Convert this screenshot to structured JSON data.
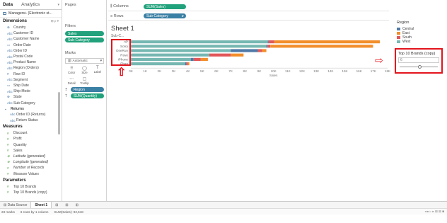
{
  "data_pane": {
    "tab_data": "Data",
    "tab_analytics": "Analytics",
    "datasource": "Managers+ (Electronic st...",
    "dimensions_title": "Dimensions",
    "dimensions_tools": "⊞ ρ ▾",
    "dimensions": [
      {
        "icon": "⊕",
        "label": "Country"
      },
      {
        "icon": "Abc",
        "label": "Customer ID"
      },
      {
        "icon": "Abc",
        "label": "Customer Name"
      },
      {
        "icon": "▭",
        "label": "Order Date"
      },
      {
        "icon": "Abc",
        "label": "Order ID"
      },
      {
        "icon": "Abc",
        "label": "Postal Code"
      },
      {
        "icon": "Abc",
        "label": "Product Name"
      },
      {
        "icon": "Abc",
        "label": "Region (Orders)"
      },
      {
        "icon": "#",
        "label": "Row ID"
      },
      {
        "icon": "Abc",
        "label": "Segment"
      },
      {
        "icon": "▭",
        "label": "Ship Date"
      },
      {
        "icon": "Abc",
        "label": "Ship Mode"
      },
      {
        "icon": "⊕",
        "label": "State"
      },
      {
        "icon": "Abc",
        "label": "Sub-Category"
      }
    ],
    "returns_group": "Returns",
    "returns_fields": [
      {
        "icon": "Abc",
        "label": "Order ID (Returns)"
      },
      {
        "icon": "Abc",
        "label": "Return Status"
      }
    ],
    "measures_title": "Measures",
    "measures": [
      {
        "icon": "#",
        "label": "Discount",
        "italic": false
      },
      {
        "icon": "#",
        "label": "Profit",
        "italic": false
      },
      {
        "icon": "#",
        "label": "Quantity",
        "italic": false
      },
      {
        "icon": "#",
        "label": "Sales",
        "italic": false
      },
      {
        "icon": "⊕",
        "label": "Latitude (generated)",
        "italic": true
      },
      {
        "icon": "⊕",
        "label": "Longitude (generated)",
        "italic": true
      },
      {
        "icon": "#",
        "label": "Number of Records",
        "italic": true
      },
      {
        "icon": "#",
        "label": "Measure Values",
        "italic": true
      }
    ],
    "parameters_title": "Parameters",
    "parameters": [
      {
        "icon": "#",
        "label": "Top 10 Brands"
      },
      {
        "icon": "#",
        "label": "Top 10 Brands (copy)"
      }
    ]
  },
  "cards": {
    "pages_title": "Pages",
    "filters_title": "Filters",
    "filters": [
      "Sales",
      "Sub-Category"
    ],
    "marks_title": "Marks",
    "mark_type": "Automatic",
    "mark_buttons": [
      {
        "icon": "⠿",
        "label": "Color"
      },
      {
        "icon": "◯",
        "label": "Size"
      },
      {
        "icon": "T",
        "label": "Label"
      },
      {
        "icon": "⋯",
        "label": "Detail"
      },
      {
        "icon": "▢",
        "label": "Tooltip"
      }
    ],
    "mark_fields": [
      {
        "icon": "⠿",
        "label": "Region",
        "color": "blue"
      },
      {
        "icon": "T",
        "label": "SUM(Quantity)",
        "color": "green"
      }
    ]
  },
  "shelves": {
    "columns_label": "Columns",
    "columns_pill": "SUM(Sales)",
    "rows_label": "Rows",
    "rows_pill": "Sub-Category"
  },
  "view": {
    "sheet_title": "Sheet 1",
    "row_header": "Sub-C..."
  },
  "chart_data": {
    "type": "bar",
    "orientation": "horizontal",
    "stacked": true,
    "categories": [
      "nP",
      "Sorry",
      "OneRun",
      "Rove",
      "iPhone",
      "Phan"
    ],
    "series": [
      {
        "name": "Central",
        "color": "#4e79a7",
        "values": [
          0.06,
          0.08,
          1.9,
          0,
          0.2,
          0.1
        ]
      },
      {
        "name": "East",
        "color": "#f28e2b",
        "values": [
          7.4,
          7.2,
          0.3,
          0.9,
          0.5,
          0.1
        ]
      },
      {
        "name": "South",
        "color": "#e15759",
        "values": [
          0.4,
          0.2,
          0.3,
          1.5,
          0.5,
          0.1
        ]
      },
      {
        "name": "West",
        "color": "#76b7b2",
        "values": [
          9.6,
          9.5,
          7.0,
          5.5,
          4.2,
          3.8
        ]
      }
    ],
    "xlabel": "Sales",
    "xlim": [
      0,
      18
    ],
    "xticks": [
      "0K",
      "1K",
      "2K",
      "3K",
      "4K",
      "5K",
      "6K",
      "7K",
      "8K",
      "9K",
      "10K",
      "11K",
      "12K",
      "13K",
      "14K",
      "15K",
      "16K",
      "17K",
      "18K"
    ]
  },
  "legend": {
    "title": "Region",
    "items": [
      {
        "label": "Central",
        "color": "#4e79a7"
      },
      {
        "label": "East",
        "color": "#f28e2b"
      },
      {
        "label": "South",
        "color": "#e15759"
      },
      {
        "label": "West",
        "color": "#76b7b2"
      }
    ]
  },
  "parameter_control": {
    "title": "Top 10 Brands (copy)",
    "value": "6",
    "slider_fraction": 0.5
  },
  "tabs": {
    "data_source": "Data Source",
    "sheet": "Sheet 1",
    "new_sheet_icons": [
      "⊞",
      "⊞",
      "⊞"
    ]
  },
  "status": {
    "marks": "23 marks",
    "rows_cols": "6 rows by 1 column",
    "sum": "SUM(Sales): 92,518",
    "right": "◂ ▸ ▹ ▸ ⊞ ⊞ ■"
  },
  "annotation_arrows": [
    "⇧",
    "⇨"
  ]
}
